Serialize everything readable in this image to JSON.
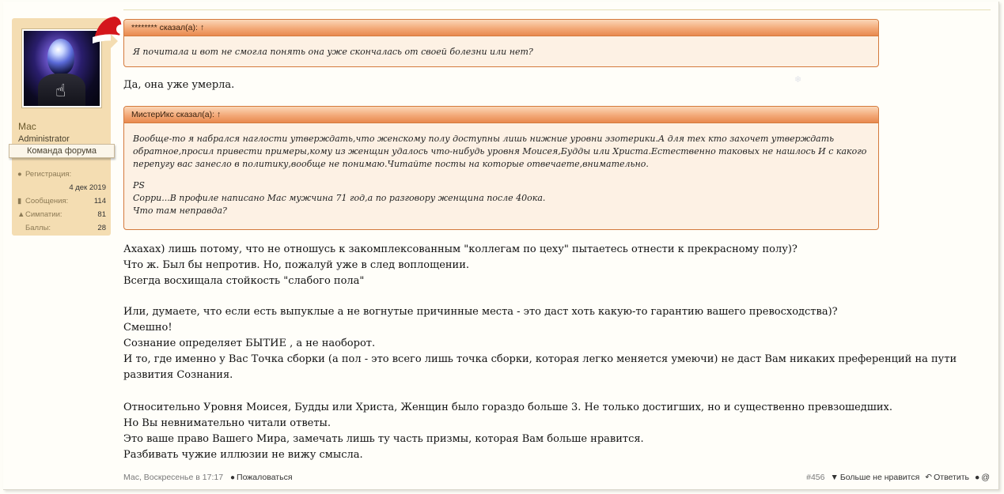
{
  "user": {
    "name": "Мас",
    "role": "Administrator",
    "banner": "Команда форума",
    "stats": [
      {
        "icon": "user-plus-icon",
        "label": "Регистрация:",
        "value": "4 дек 2019"
      },
      {
        "icon": "comments-icon",
        "label": "Сообщения:",
        "value": "114"
      },
      {
        "icon": "thumbs-up-icon",
        "label": "Симпатии:",
        "value": "81"
      },
      {
        "icon": "trophy-icon",
        "label": "Баллы:",
        "value": "28"
      }
    ]
  },
  "quotes": [
    {
      "author": "******** сказал(а):",
      "arrow": "↑",
      "lines": [
        "Я почитала и вот не смогла понять она уже скончалась от своей болезни или нет?"
      ]
    },
    {
      "author": "МистерИкс сказал(а):",
      "arrow": "↑",
      "lines": [
        "Вообще-то я набрался наглости утверждать,что женскому полу доступны лишь нижние уровни эзотерики.А для тех кто захочет утверждать",
        "обратное,просил привести примеры,кому из женщин удалось что-нибудь уровня Моисея,Будды или Христа.Естественно таковых не нашлось И с какого",
        "перепугу вас занесло в политику,вообще не понимаю.Читайте посты на которые отвечаете,внимательно.",
        "",
        "PS",
        "Сорри...В профиле написано Мас мужчина 71 год,а по разговору женщина после 40ока.",
        "Что там неправда?"
      ]
    }
  ],
  "reply_after_first_quote": "Да, она уже умерла.",
  "paragraphs": [
    [
      "Ахахах) лишь потому, что не отношусь к закомплексованным \"коллегам по цеху\" пытаетесь отнести к прекрасному полу)?",
      "Что ж. Был бы непротив. Но, пожалуй уже в след воплощении.",
      "Всегда восхищала стойкость \"слабого пола\""
    ],
    [
      "Или, думаете, что если есть выпуклые а не вогнутые причинные места - это даст хоть какую-то гарантию вашего превосходства)?",
      "Смешно!",
      "Сознание определяет БЫТИЕ , а не наоборот.",
      "И то, где именно у Вас Точка сборки (а пол - это всего лишь точка сборки, которая легко меняется умеючи) не даст Вам никаких преференций на пути",
      "развития Сознания."
    ],
    [
      "Относительно Уровня Моисея, Будды или Христа, Женщин было гораздо больше 3. Не только достигших, но и существенно превзошедших.",
      "Но Вы невнимательно читали ответы.",
      "Это ваше право Вашего Мира, замечать лишь ту часть призмы, которая Вам больше нравится.",
      "Разбивать чужие иллюзии не вижу смысла."
    ]
  ],
  "footer": {
    "meta": "Мас, Воскресенье в 17:17",
    "report": "Пожаловаться",
    "post_number": "#456",
    "dislike": "Больше не нравится",
    "reply": "Ответить",
    "mention": "@"
  },
  "colors": {
    "quote_border": "#d47a3d",
    "quote_header": "#f3a978",
    "quote_bg": "#fdf1e4",
    "sidebar_bg": "#f4ddb2",
    "page_bg": "#fffef9"
  }
}
